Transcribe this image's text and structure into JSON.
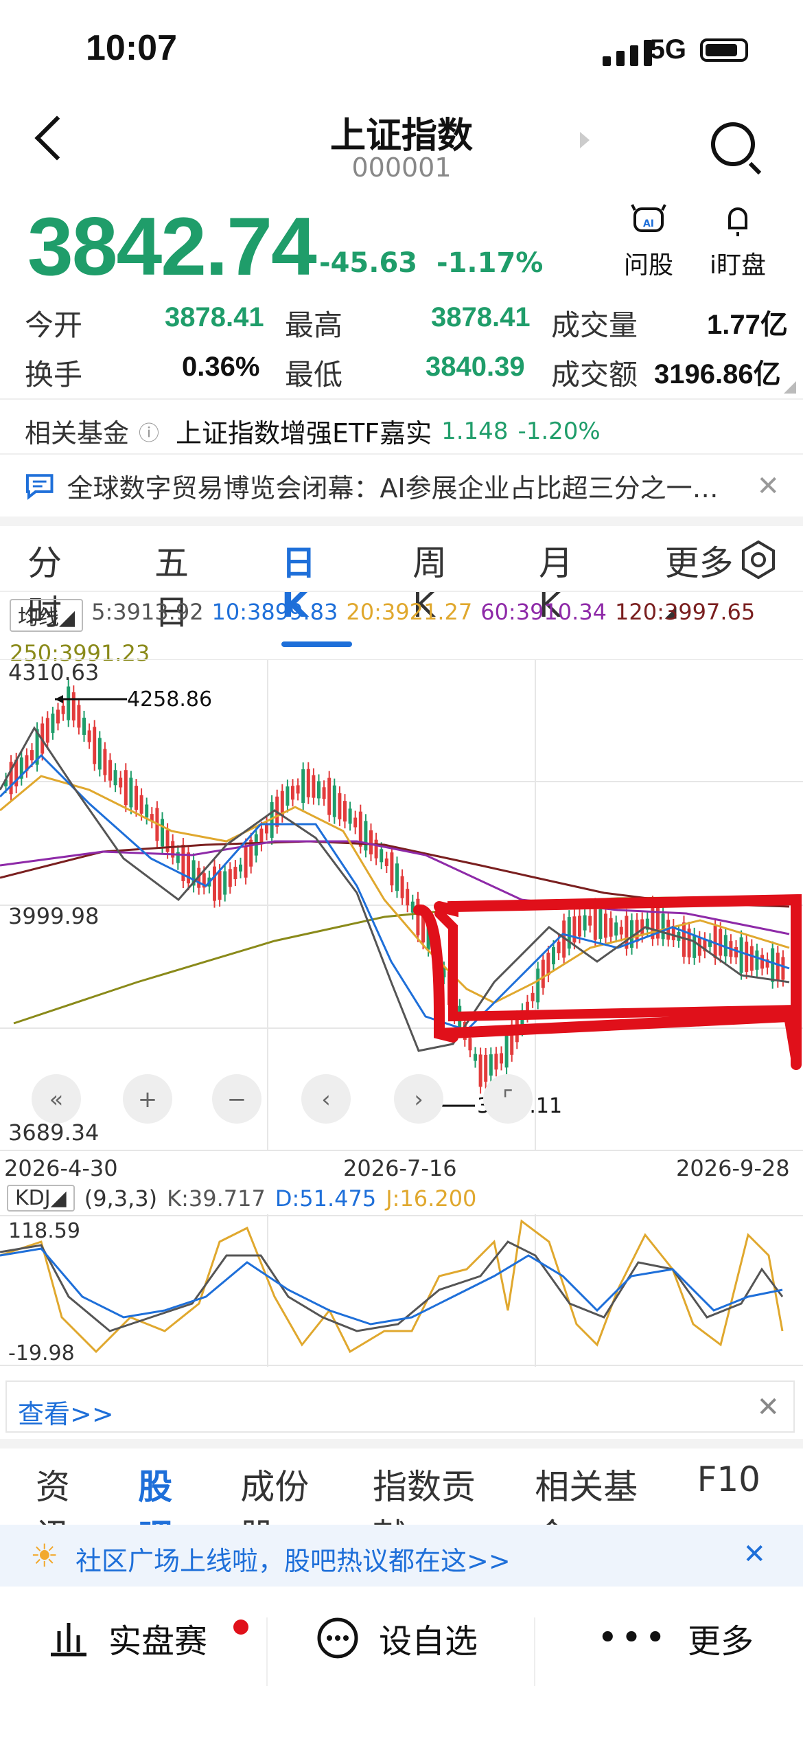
{
  "status": {
    "time": "10:07",
    "network": "5G"
  },
  "header": {
    "title": "上证指数",
    "code": "000001"
  },
  "quote": {
    "price": "3842.74",
    "change": "-45.63",
    "change_pct": "-1.17%"
  },
  "tools": {
    "ask": "问股",
    "watch": "i盯盘",
    "ai_badge": "AI"
  },
  "stats": {
    "open_label": "今开",
    "open": "3878.41",
    "high_label": "最高",
    "high": "3878.41",
    "volume_label": "成交量",
    "volume": "1.77亿",
    "turnover_label": "换手",
    "turnover": "0.36%",
    "low_label": "最低",
    "low": "3840.39",
    "amount_label": "成交额",
    "amount": "3196.86亿"
  },
  "fund": {
    "label": "相关基金",
    "info": "ⓘ",
    "name": "上证指数增强ETF嘉实",
    "price": "1.148",
    "pct": "-1.20%"
  },
  "news": {
    "text": "全球数字贸易博览会闭幕：AI参展企业占比超三分之一…",
    "close": "✕"
  },
  "tabs": [
    {
      "label": "分时"
    },
    {
      "label": "五日"
    },
    {
      "label": "日 K"
    },
    {
      "label": "周 K"
    },
    {
      "label": "月 K"
    },
    {
      "label": "更多"
    }
  ],
  "ma": {
    "chip": "均线",
    "items": [
      {
        "text": "5:3913.92",
        "color": "#555555"
      },
      {
        "text": "10:3899.83",
        "color": "#1e6fd9"
      },
      {
        "text": "20:3921.27",
        "color": "#e0a82e"
      },
      {
        "text": "60:3910.34",
        "color": "#8e2aa8"
      },
      {
        "text": "120:3997.65",
        "color": "#7a1f1f"
      },
      {
        "text": "250:3991.23",
        "color": "#8a8a1a"
      }
    ]
  },
  "chart_data": {
    "type": "candlestick",
    "y_labels": [
      "4310.63",
      "3999.98",
      "3689.34"
    ],
    "ylim": [
      3689.34,
      4310.63
    ],
    "x_labels": [
      "2026-4-30",
      "2026-7-16",
      "2026-9-28"
    ],
    "annotations": {
      "high": "4258.86",
      "low": "3741.11"
    }
  },
  "kdj": {
    "chip": "KDJ",
    "params": "(9,3,3)",
    "k": "K:39.717",
    "d": "D:51.475",
    "j": "J:16.200",
    "top": "118.59",
    "bottom": "-19.98"
  },
  "view": {
    "text": "查看>>",
    "close": "✕"
  },
  "bottom_tabs": [
    {
      "label": "资讯"
    },
    {
      "label": "股吧"
    },
    {
      "label": "成份股"
    },
    {
      "label": "指数贡献"
    },
    {
      "label": "相关基金"
    },
    {
      "label": "F10"
    }
  ],
  "banner": {
    "text": "社区广场上线啦，股吧热议都在这>>",
    "close": "✕"
  },
  "bottom_nav": {
    "contest": "实盘赛",
    "add": "设自选",
    "more": "更多"
  }
}
